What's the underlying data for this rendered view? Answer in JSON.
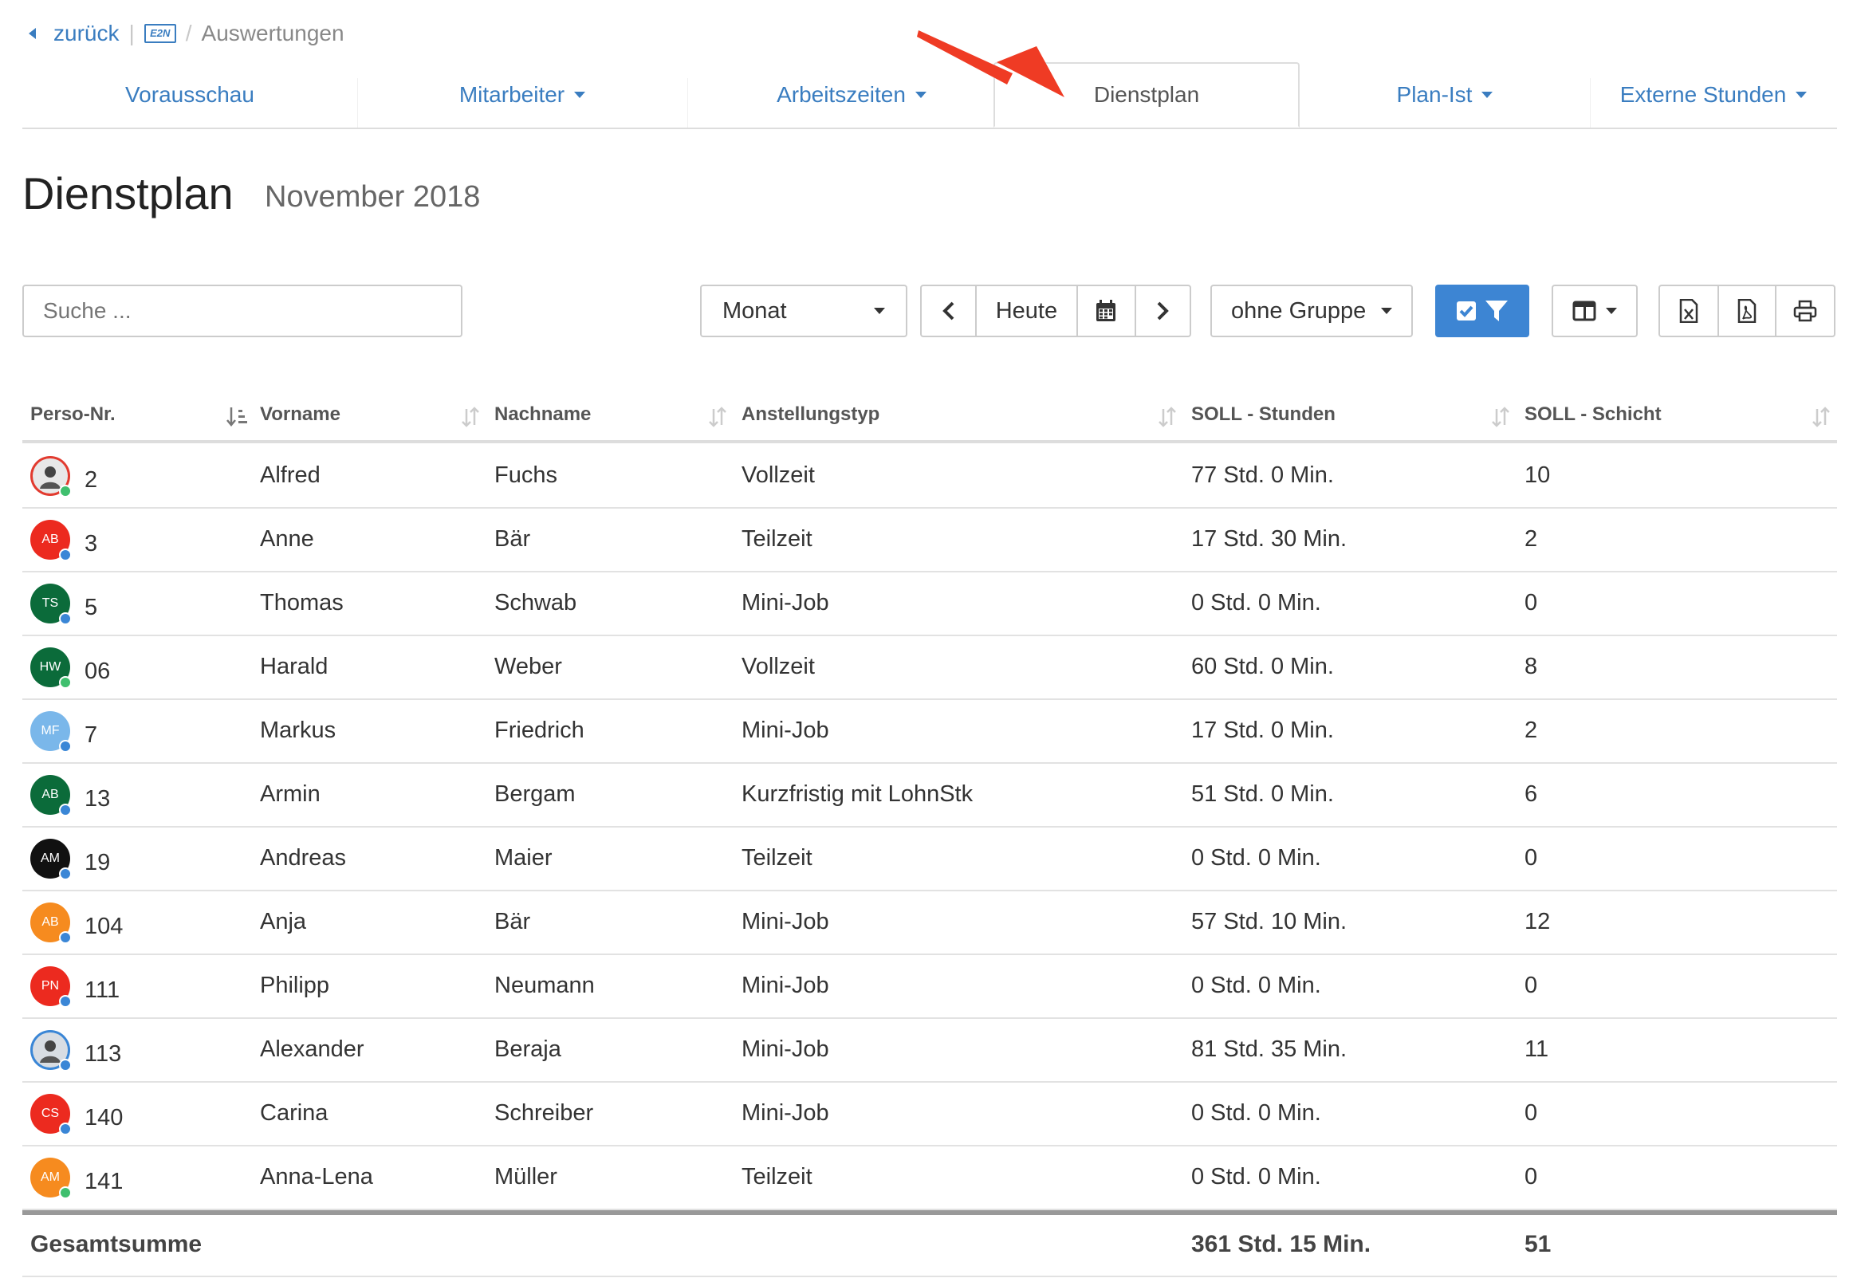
{
  "breadcrumb": {
    "back": "zurück",
    "logo": "E2N",
    "current": "Auswertungen"
  },
  "tabs": [
    {
      "label": "Vorausschau",
      "dropdown": false,
      "active": false
    },
    {
      "label": "Mitarbeiter",
      "dropdown": true,
      "active": false
    },
    {
      "label": "Arbeitszeiten",
      "dropdown": true,
      "active": false
    },
    {
      "label": "Dienstplan",
      "dropdown": false,
      "active": true
    },
    {
      "label": "Plan-Ist",
      "dropdown": true,
      "active": false
    },
    {
      "label": "Externe Stunden",
      "dropdown": true,
      "active": false
    }
  ],
  "page": {
    "title": "Dienstplan",
    "period": "November 2018"
  },
  "toolbar": {
    "search_placeholder": "Suche ...",
    "range_select": "Monat",
    "today": "Heute",
    "group_select": "ohne Gruppe"
  },
  "table": {
    "columns": [
      "Perso-Nr.",
      "Vorname",
      "Nachname",
      "Anstellungstyp",
      "SOLL - Stunden",
      "SOLL - Schicht"
    ],
    "rows": [
      {
        "nr": "2",
        "first": "Alfred",
        "last": "Fuchs",
        "type": "Vollzeit",
        "hours": "77 Std. 0 Min.",
        "shifts": "10",
        "initials": "",
        "color": "#e8e8e8",
        "photo": true,
        "ring": "#e23b2f",
        "status": "#3fbf6e"
      },
      {
        "nr": "3",
        "first": "Anne",
        "last": "Bär",
        "type": "Teilzeit",
        "hours": "17 Std. 30 Min.",
        "shifts": "2",
        "initials": "AB",
        "color": "#ec2a1f",
        "status": "#3a86d6"
      },
      {
        "nr": "5",
        "first": "Thomas",
        "last": "Schwab",
        "type": "Mini-Job",
        "hours": "0 Std. 0 Min.",
        "shifts": "0",
        "initials": "TS",
        "color": "#0b6b3a",
        "status": "#3a86d6"
      },
      {
        "nr": "06",
        "first": "Harald",
        "last": "Weber",
        "type": "Vollzeit",
        "hours": "60 Std. 0 Min.",
        "shifts": "8",
        "initials": "HW",
        "color": "#0b6b3a",
        "status": "#3fbf6e"
      },
      {
        "nr": "7",
        "first": "Markus",
        "last": "Friedrich",
        "type": "Mini-Job",
        "hours": "17 Std. 0 Min.",
        "shifts": "2",
        "initials": "MF",
        "color": "#7ab7ea",
        "status": "#3a86d6"
      },
      {
        "nr": "13",
        "first": "Armin",
        "last": "Bergam",
        "type": "Kurzfristig mit LohnStk",
        "hours": "51 Std. 0 Min.",
        "shifts": "6",
        "initials": "AB",
        "color": "#0b6b3a",
        "status": "#3a86d6"
      },
      {
        "nr": "19",
        "first": "Andreas",
        "last": "Maier",
        "type": "Teilzeit",
        "hours": "0 Std. 0 Min.",
        "shifts": "0",
        "initials": "AM",
        "color": "#111111",
        "status": "#3a86d6"
      },
      {
        "nr": "104",
        "first": "Anja",
        "last": "Bär",
        "type": "Mini-Job",
        "hours": "57 Std. 10 Min.",
        "shifts": "12",
        "initials": "AB",
        "color": "#f68b1f",
        "status": "#3a86d6"
      },
      {
        "nr": "111",
        "first": "Philipp",
        "last": "Neumann",
        "type": "Mini-Job",
        "hours": "0 Std. 0 Min.",
        "shifts": "0",
        "initials": "PN",
        "color": "#ec2a1f",
        "status": "#3a86d6"
      },
      {
        "nr": "113",
        "first": "Alexander",
        "last": "Beraja",
        "type": "Mini-Job",
        "hours": "81 Std. 35 Min.",
        "shifts": "11",
        "initials": "",
        "color": "#d8dde3",
        "photo": true,
        "ring": "#3a86d6",
        "status": "#3a86d6"
      },
      {
        "nr": "140",
        "first": "Carina",
        "last": "Schreiber",
        "type": "Mini-Job",
        "hours": "0 Std. 0 Min.",
        "shifts": "0",
        "initials": "CS",
        "color": "#ec2a1f",
        "status": "#3a86d6"
      },
      {
        "nr": "141",
        "first": "Anna-Lena",
        "last": "Müller",
        "type": "Teilzeit",
        "hours": "0 Std. 0 Min.",
        "shifts": "0",
        "initials": "AM",
        "color": "#f68b1f",
        "status": "#3fbf6e"
      }
    ],
    "total": {
      "label": "Gesamtsumme",
      "hours": "361 Std. 15 Min.",
      "shifts": "51"
    }
  },
  "colors": {
    "accent": "#3a7dc0",
    "primary_button": "#3d85d3",
    "annotation_arrow": "#ef3b24"
  }
}
